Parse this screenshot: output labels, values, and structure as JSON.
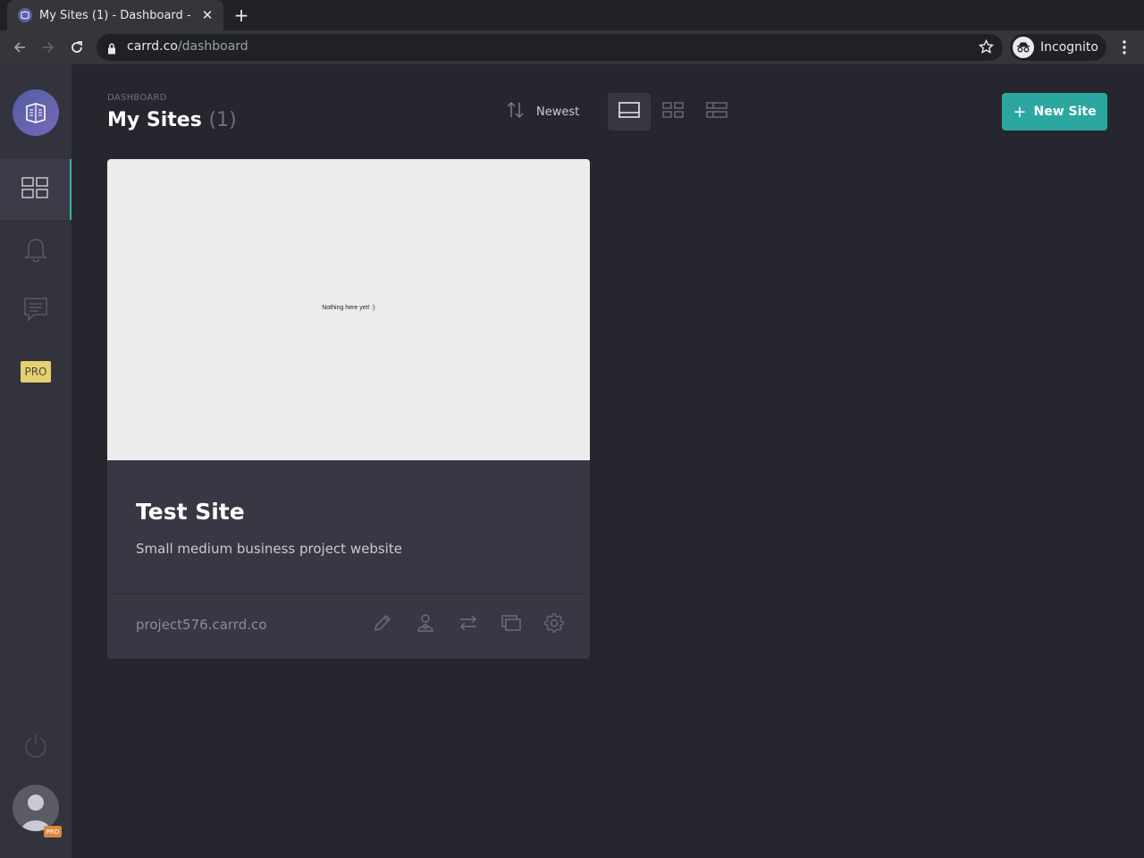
{
  "browser": {
    "tab_title": "My Sites (1) - Dashboard - ",
    "url_host": "carrd.co",
    "url_path": "/dashboard",
    "profile_label": "Incognito"
  },
  "sidebar": {
    "items": [
      {
        "name": "dashboard",
        "icon": "grid-icon",
        "active": true
      },
      {
        "name": "notifications",
        "icon": "bell-icon"
      },
      {
        "name": "messages",
        "icon": "chat-icon"
      },
      {
        "name": "pro",
        "label": "PRO"
      }
    ],
    "logout_icon": "power-icon",
    "avatar_badge": "PRO"
  },
  "header": {
    "breadcrumb": "DASHBOARD",
    "title": "My Sites",
    "count": "(1)",
    "sort_label": "Newest",
    "new_site_label": "New Site"
  },
  "sites": [
    {
      "preview_text": "Nothing here yet! :)",
      "title": "Test Site",
      "description": "Small medium business project website",
      "url": "project576.carrd.co",
      "actions": [
        "pencil-icon",
        "share-users-icon",
        "transfer-icon",
        "duplicate-icon",
        "gear-icon"
      ]
    }
  ],
  "colors": {
    "accent": "#2ca7a0",
    "background": "#26272e",
    "sidebar": "#32333d",
    "card": "#373843",
    "pro_badge": "#e5d070"
  }
}
